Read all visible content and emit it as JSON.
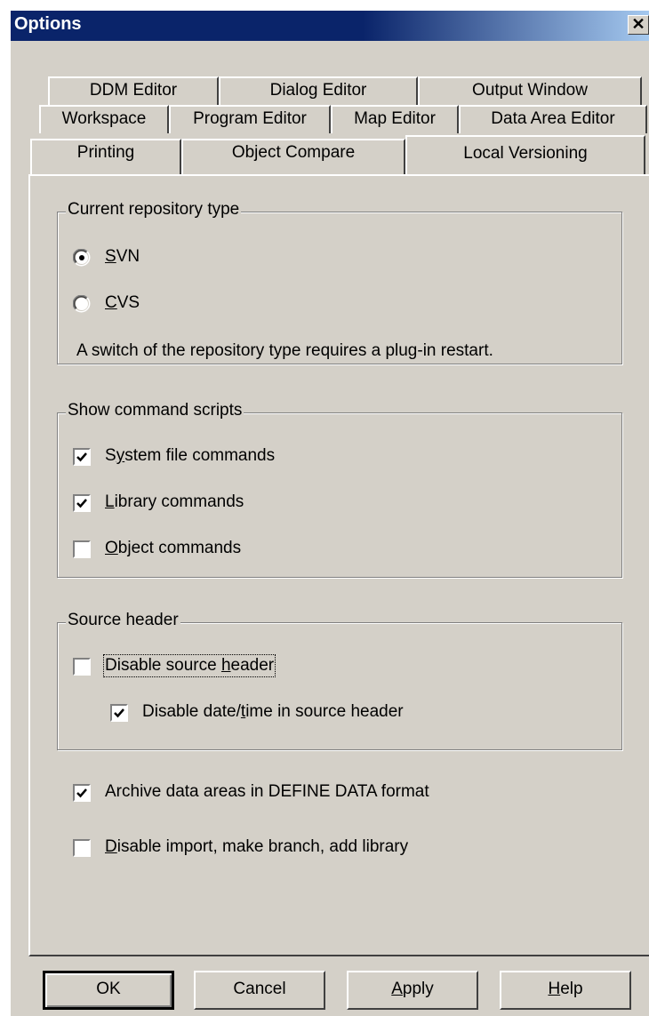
{
  "window": {
    "title": "Options",
    "close_glyph": "✕"
  },
  "tabs": {
    "row1": [
      "DDM Editor",
      "Dialog Editor",
      "Output Window"
    ],
    "row2": [
      "Workspace",
      "Program Editor",
      "Map Editor",
      "Data Area Editor"
    ],
    "row3": [
      "Printing",
      "Object Compare",
      "Local Versioning"
    ],
    "active": "Local Versioning"
  },
  "repository": {
    "legend": "Current repository type",
    "options": [
      {
        "mnemonic": "S",
        "rest": "VN",
        "label": "SVN",
        "selected": true
      },
      {
        "mnemonic": "C",
        "rest": "VS",
        "label": "CVS",
        "selected": false
      }
    ],
    "note": "A switch of the repository type requires a plug-in restart."
  },
  "command_scripts": {
    "legend": "Show command scripts",
    "items": [
      {
        "pre": "S",
        "mnemonic": "y",
        "post": "stem file commands",
        "checked": true
      },
      {
        "pre": "",
        "mnemonic": "L",
        "post": "ibrary commands",
        "checked": true
      },
      {
        "pre": "",
        "mnemonic": "O",
        "post": "bject commands",
        "checked": false
      }
    ]
  },
  "source_header": {
    "legend": "Source header",
    "disable": {
      "pre": "Disable source ",
      "mnemonic": "h",
      "post": "eader",
      "checked": false
    },
    "disable_datetime": {
      "pre": "Disable date/",
      "mnemonic": "t",
      "post": "ime in source header",
      "checked": true
    }
  },
  "archive": {
    "text": "Archive data areas in DEFINE DATA format",
    "checked": true
  },
  "disable_import": {
    "mnemonic": "D",
    "post": "isable import, make branch, add library",
    "checked": false
  },
  "buttons": {
    "ok": "OK",
    "cancel": "Cancel",
    "apply": {
      "mnemonic": "A",
      "post": "pply"
    },
    "help": {
      "mnemonic": "H",
      "post": "elp"
    }
  },
  "colors": {
    "face": "#d4d0c8",
    "titlebar_start": "#0a246a",
    "titlebar_end": "#a6caf0"
  }
}
